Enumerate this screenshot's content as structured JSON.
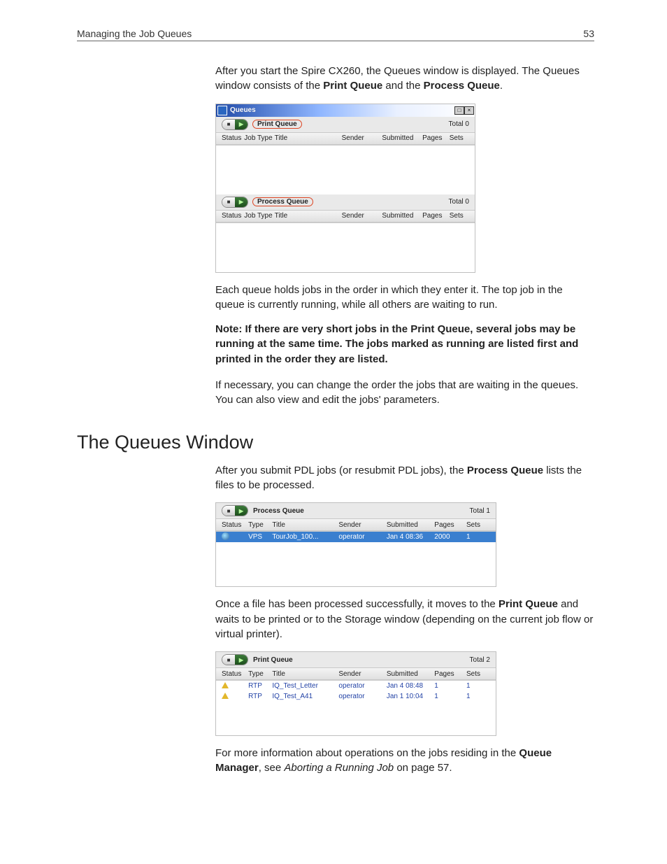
{
  "header": {
    "left": "Managing the Job Queues",
    "right": "53"
  },
  "intro_before": "After you start the Spire CX260, the Queues window is displayed. The Queues window consists of the ",
  "intro_bold1": "Print Queue",
  "intro_mid": " and the ",
  "intro_bold2": "Process Queue",
  "intro_end": ".",
  "queues_window": {
    "title": "Queues",
    "print": {
      "label": "Print Queue",
      "total": "Total 0",
      "cols": [
        "Status",
        "Job Type",
        "Title",
        "Sender",
        "Submitted",
        "Pages",
        "Sets"
      ]
    },
    "process": {
      "label": "Process Queue",
      "total": "Total 0",
      "cols": [
        "Status",
        "Job Type",
        "Title",
        "Sender",
        "Submitted",
        "Pages",
        "Sets"
      ]
    }
  },
  "para2": "Each queue holds jobs in the order in which they enter it. The top job in the queue is currently running, while all others are waiting to run.",
  "note_label": "Note:",
  "note_t1": "  If there are very short jobs in the ",
  "note_b1": "Print Queue",
  "note_t2": ", several jobs may be running at the same time. The jobs marked as ",
  "note_b2": "running",
  "note_t3": " are listed first and printed in the order they are listed.",
  "para3": "If necessary, you can change the order the jobs that are waiting in the queues. You can also view and edit the jobs' parameters.",
  "section_heading": "The Queues Window",
  "para4_a": "After you submit PDL jobs (or resubmit PDL jobs), the ",
  "para4_b": "Process Queue",
  "para4_c": " lists the files to be processed.",
  "process_panel": {
    "label": "Process Queue",
    "total": "Total 1",
    "cols": [
      "Status",
      "Type",
      "Title",
      "Sender",
      "Submitted",
      "Pages",
      "Sets"
    ],
    "rows": [
      {
        "type": "VPS",
        "title": "TourJob_100...",
        "sender": "operator",
        "submitted": "Jan 4 08:36",
        "pages": "2000",
        "sets": "1"
      }
    ]
  },
  "para5_a": "Once a file has been processed successfully, it moves to the ",
  "para5_b": "Print Queue",
  "para5_c": " and waits to be printed or to the Storage window (depending on the current job flow or virtual printer).",
  "print_panel": {
    "label": "Print Queue",
    "total": "Total 2",
    "cols": [
      "Status",
      "Type",
      "Title",
      "Sender",
      "Submitted",
      "Pages",
      "Sets"
    ],
    "rows": [
      {
        "type": "RTP",
        "title": "IQ_Test_Letter",
        "sender": "operator",
        "submitted": "Jan 4 08:48",
        "pages": "1",
        "sets": "1"
      },
      {
        "type": "RTP",
        "title": "IQ_Test_A41",
        "sender": "operator",
        "submitted": "Jan 1 10:04",
        "pages": "1",
        "sets": "1"
      }
    ]
  },
  "para6_a": "For more information about operations on the jobs residing in the ",
  "para6_b": "Queue Manager",
  "para6_c": ", see ",
  "para6_d": "Aborting a Running Job",
  "para6_e": " on page 57."
}
